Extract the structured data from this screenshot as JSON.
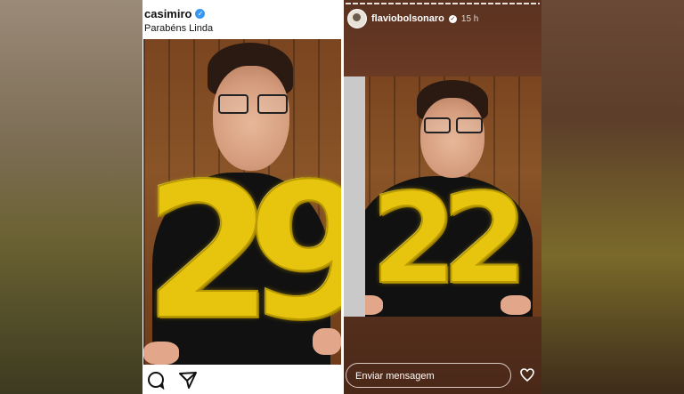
{
  "post": {
    "username": "casimiro",
    "caption": "Parabéns Linda",
    "balloon_text": "29"
  },
  "story": {
    "username": "flaviobolsonaro",
    "time": "15 h",
    "balloon_text": "22",
    "reply_placeholder": "Enviar mensagem"
  },
  "colors": {
    "verified_blue": "#3897f0",
    "balloon_gold": "#e7c40d",
    "story_bg": "#5a3220"
  }
}
